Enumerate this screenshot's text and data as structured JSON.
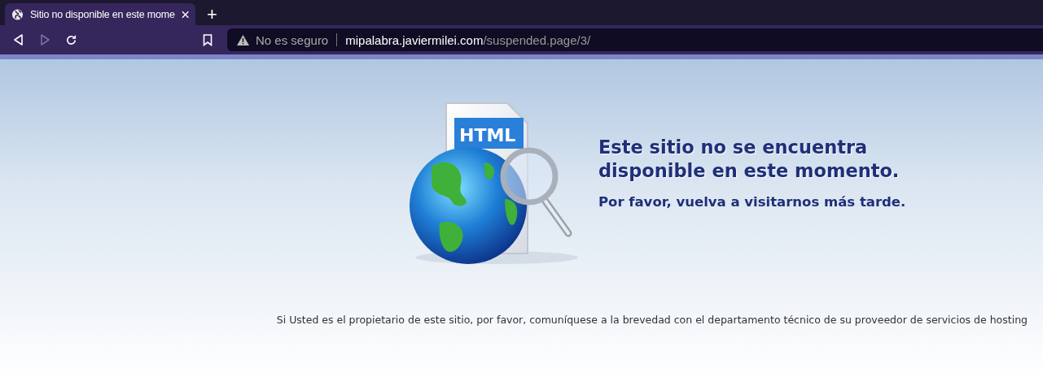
{
  "tabs": [
    {
      "title": "Sitio no disponible en este mome",
      "selected": true
    }
  ],
  "new_tab": "+",
  "address_bar": {
    "security": "No es seguro",
    "url_host": "mipalabra.javiermilei.com",
    "url_path": "/suspended.page/3/"
  },
  "page": {
    "illustration_label": "HTML",
    "heading": "Este sitio no se encuentra disponible en este momento.",
    "subheading": "Por favor, vuelva a visitarnos más tarde.",
    "footer": "Si Usted es el propietario de este sitio, por favor, comuníquese a la brevedad con el departamento técnico de su proveedor de servicios de hosting"
  }
}
